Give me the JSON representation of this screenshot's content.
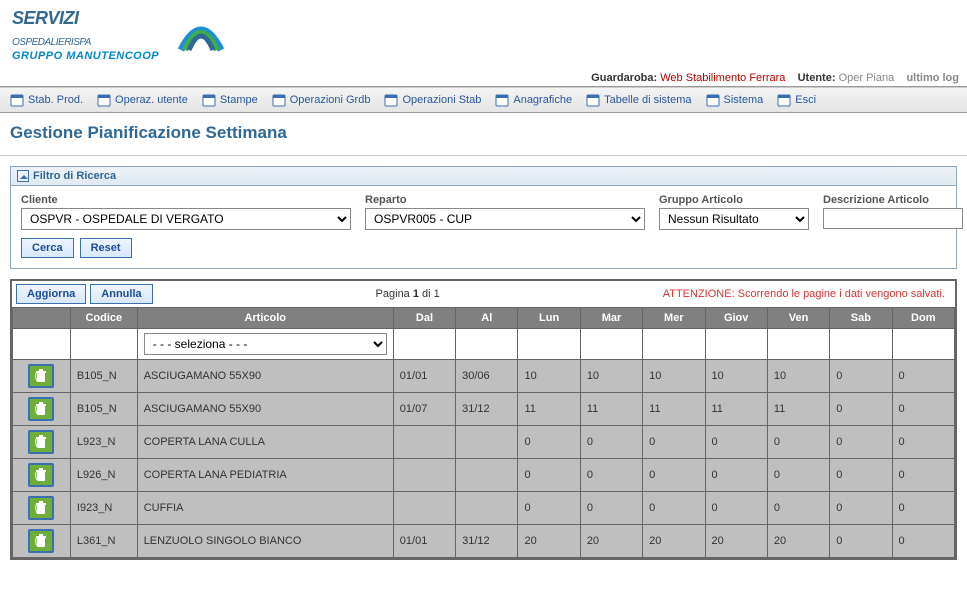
{
  "branding": {
    "line1": "SERVIZI",
    "line2": "OSPEDALIERI",
    "line2_suffix": "SPA",
    "line3": "GRUPPO MANUTENCOOP"
  },
  "infobar": {
    "guardaroba_lbl": "Guardaroba:",
    "guardaroba_val": "Web Stabilimento Ferrara",
    "utente_lbl": "Utente:",
    "utente_val": "Oper Piana",
    "lastlog_lbl": "ultimo log"
  },
  "menu": [
    "Stab. Prod.",
    "Operaz. utente",
    "Stampe",
    "Operazioni Grdb",
    "Operazioni Stab",
    "Anagrafiche",
    "Tabelle di sistema",
    "Sistema",
    "Esci"
  ],
  "page_title": "Gestione Pianificazione Settimana",
  "filter": {
    "panel_title": "Filtro di Ricerca",
    "cliente_lbl": "Cliente",
    "cliente_val": "OSPVR - OSPEDALE DI VERGATO",
    "reparto_lbl": "Reparto",
    "reparto_val": "OSPVR005 - CUP",
    "gruppo_lbl": "Gruppo Articolo",
    "gruppo_val": "Nessun Risultato",
    "descr_lbl": "Descrizione Articolo",
    "descr_val": "",
    "cerca": "Cerca",
    "reset": "Reset"
  },
  "grid": {
    "aggiorna": "Aggiorna",
    "annulla": "Annulla",
    "pager_prefix": "Pagina ",
    "pager_cur": "1",
    "pager_suffix": " di 1",
    "warn": "ATTENZIONE: Scorrendo le pagine i dati vengono salvati.",
    "headers": {
      "codice": "Codice",
      "articolo": "Articolo",
      "dal": "Dal",
      "al": "Al",
      "lun": "Lun",
      "mar": "Mar",
      "mer": "Mer",
      "gio": "Giov",
      "ven": "Ven",
      "sab": "Sab",
      "dom": "Dom"
    },
    "filter_placeholder": "- - - seleziona - - -",
    "rows": [
      {
        "codice": "B105_N",
        "articolo": "ASCIUGAMANO 55X90",
        "dal": "01/01",
        "al": "30/06",
        "lun": "10",
        "mar": "10",
        "mer": "10",
        "gio": "10",
        "ven": "10",
        "sab": "0",
        "dom": "0"
      },
      {
        "codice": "B105_N",
        "articolo": "ASCIUGAMANO 55X90",
        "dal": "01/07",
        "al": "31/12",
        "lun": "11",
        "mar": "11",
        "mer": "11",
        "gio": "11",
        "ven": "11",
        "sab": "0",
        "dom": "0"
      },
      {
        "codice": "L923_N",
        "articolo": "COPERTA LANA CULLA",
        "dal": "",
        "al": "",
        "lun": "0",
        "mar": "0",
        "mer": "0",
        "gio": "0",
        "ven": "0",
        "sab": "0",
        "dom": "0"
      },
      {
        "codice": "L926_N",
        "articolo": "COPERTA LANA PEDIATRIA",
        "dal": "",
        "al": "",
        "lun": "0",
        "mar": "0",
        "mer": "0",
        "gio": "0",
        "ven": "0",
        "sab": "0",
        "dom": "0"
      },
      {
        "codice": "I923_N",
        "articolo": "CUFFIA",
        "dal": "",
        "al": "",
        "lun": "0",
        "mar": "0",
        "mer": "0",
        "gio": "0",
        "ven": "0",
        "sab": "0",
        "dom": "0"
      },
      {
        "codice": "L361_N",
        "articolo": "LENZUOLO SINGOLO BIANCO",
        "dal": "01/01",
        "al": "31/12",
        "lun": "20",
        "mar": "20",
        "mer": "20",
        "gio": "20",
        "ven": "20",
        "sab": "0",
        "dom": "0"
      }
    ]
  }
}
